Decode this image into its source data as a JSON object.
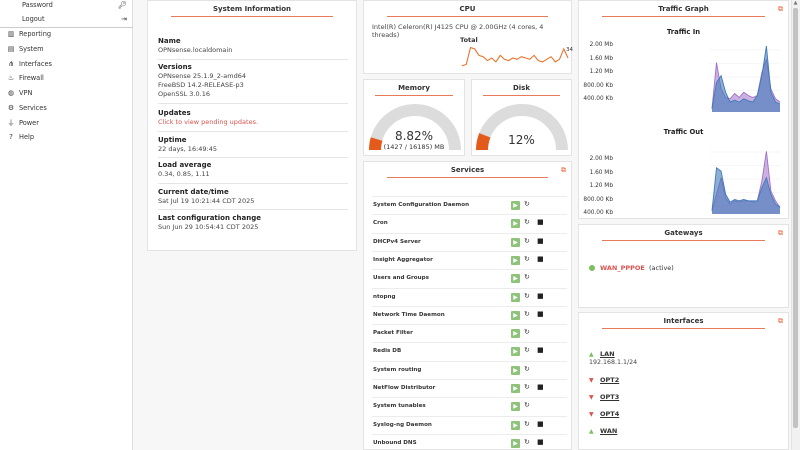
{
  "sidebar": {
    "sub_items": [
      {
        "label": "Password",
        "icon": "key-icon"
      },
      {
        "label": "Logout",
        "icon": "logout-icon"
      }
    ],
    "items": [
      {
        "label": "Reporting",
        "icon": "chart-icon"
      },
      {
        "label": "System",
        "icon": "server-icon"
      },
      {
        "label": "Interfaces",
        "icon": "network-icon"
      },
      {
        "label": "Firewall",
        "icon": "fire-icon"
      },
      {
        "label": "VPN",
        "icon": "globe-icon"
      },
      {
        "label": "Services",
        "icon": "gear-icon"
      },
      {
        "label": "Power",
        "icon": "plug-icon"
      },
      {
        "label": "Help",
        "icon": "help-icon"
      }
    ]
  },
  "system_info": {
    "title": "System Information",
    "name_label": "Name",
    "name_value": "OPNsense.localdomain",
    "versions_label": "Versions",
    "versions": [
      "OPNsense 25.1.9_2-amd64",
      "FreeBSD 14.2-RELEASE-p3",
      "OpenSSL 3.0.16"
    ],
    "updates_label": "Updates",
    "updates_link": "Click to view pending updates.",
    "uptime_label": "Uptime",
    "uptime_value": "22 days, 16:49:45",
    "load_label": "Load average",
    "load_value": "0.34, 0.85, 1.11",
    "date_label": "Current date/time",
    "date_value": "Sat Jul 19 10:21:44 CDT 2025",
    "config_label": "Last configuration change",
    "config_value": "Sun Jun 29 10:54:41 CDT 2025"
  },
  "cpu": {
    "title": "CPU",
    "model": "Intel(R) Celeron(R) J4125 CPU @ 2.00GHz (4 cores, 4 threads)",
    "total_label": "Total",
    "current": "34",
    "history": [
      0.2,
      0.25,
      0.9,
      0.85,
      0.6,
      0.55,
      0.4,
      0.5,
      0.35,
      0.6,
      0.45,
      0.4,
      0.5,
      0.45,
      0.55,
      0.5,
      0.45,
      0.6,
      0.4,
      0.35,
      0.45,
      0.55,
      0.35,
      0.45,
      0.85,
      0.5
    ],
    "line_color": "#e8742e"
  },
  "memory": {
    "title": "Memory",
    "percent_text": "8.82%",
    "detail": "(1427 / 16185) MB",
    "fraction": 0.0882,
    "fill_color": "#e35a1b"
  },
  "disk": {
    "title": "Disk",
    "percent_text": "12%",
    "fraction": 0.12,
    "fill_color": "#e35a1b"
  },
  "services": {
    "title": "Services",
    "rows": [
      {
        "name": "System Configuration Daemon",
        "stop": false
      },
      {
        "name": "Cron",
        "stop": true
      },
      {
        "name": "DHCPv4 Server",
        "stop": true
      },
      {
        "name": "Insight Aggregator",
        "stop": true
      },
      {
        "name": "Users and Groups",
        "stop": false
      },
      {
        "name": "ntopng",
        "stop": true
      },
      {
        "name": "Network Time Daemon",
        "stop": true
      },
      {
        "name": "Packet Filter",
        "stop": false
      },
      {
        "name": "Redis DB",
        "stop": true
      },
      {
        "name": "System routing",
        "stop": false
      },
      {
        "name": "NetFlow Distributor",
        "stop": true
      },
      {
        "name": "System tunables",
        "stop": false
      },
      {
        "name": "Syslog-ng Daemon",
        "stop": true
      },
      {
        "name": "Unbound DNS",
        "stop": true
      }
    ]
  },
  "traffic": {
    "title": "Traffic Graph",
    "in_label": "Traffic In",
    "out_label": "Traffic Out",
    "in_ticks": [
      "2.00 Mb",
      "1.60 Mb",
      "1.20 Mb",
      "800.00 Kb",
      "400.00 Kb"
    ],
    "out_ticks": [
      "2.00 Mb",
      "1.60 Mb",
      "1.20 Mb",
      "800.00 Kb",
      "400.00 Kb"
    ],
    "series_colors": [
      "#a070c8",
      "#3f7ab8"
    ]
  },
  "gateways": {
    "title": "Gateways",
    "items": [
      {
        "name": "WAN_PPPOE",
        "status": "(active)"
      }
    ]
  },
  "interfaces": {
    "title": "Interfaces",
    "items": [
      {
        "name": "LAN",
        "up": true,
        "address": "192.168.1.1/24"
      },
      {
        "name": "OPT2",
        "up": false,
        "address": ""
      },
      {
        "name": "OPT3",
        "up": false,
        "address": ""
      },
      {
        "name": "OPT4",
        "up": false,
        "address": ""
      },
      {
        "name": "WAN",
        "up": true,
        "address": ""
      }
    ]
  }
}
